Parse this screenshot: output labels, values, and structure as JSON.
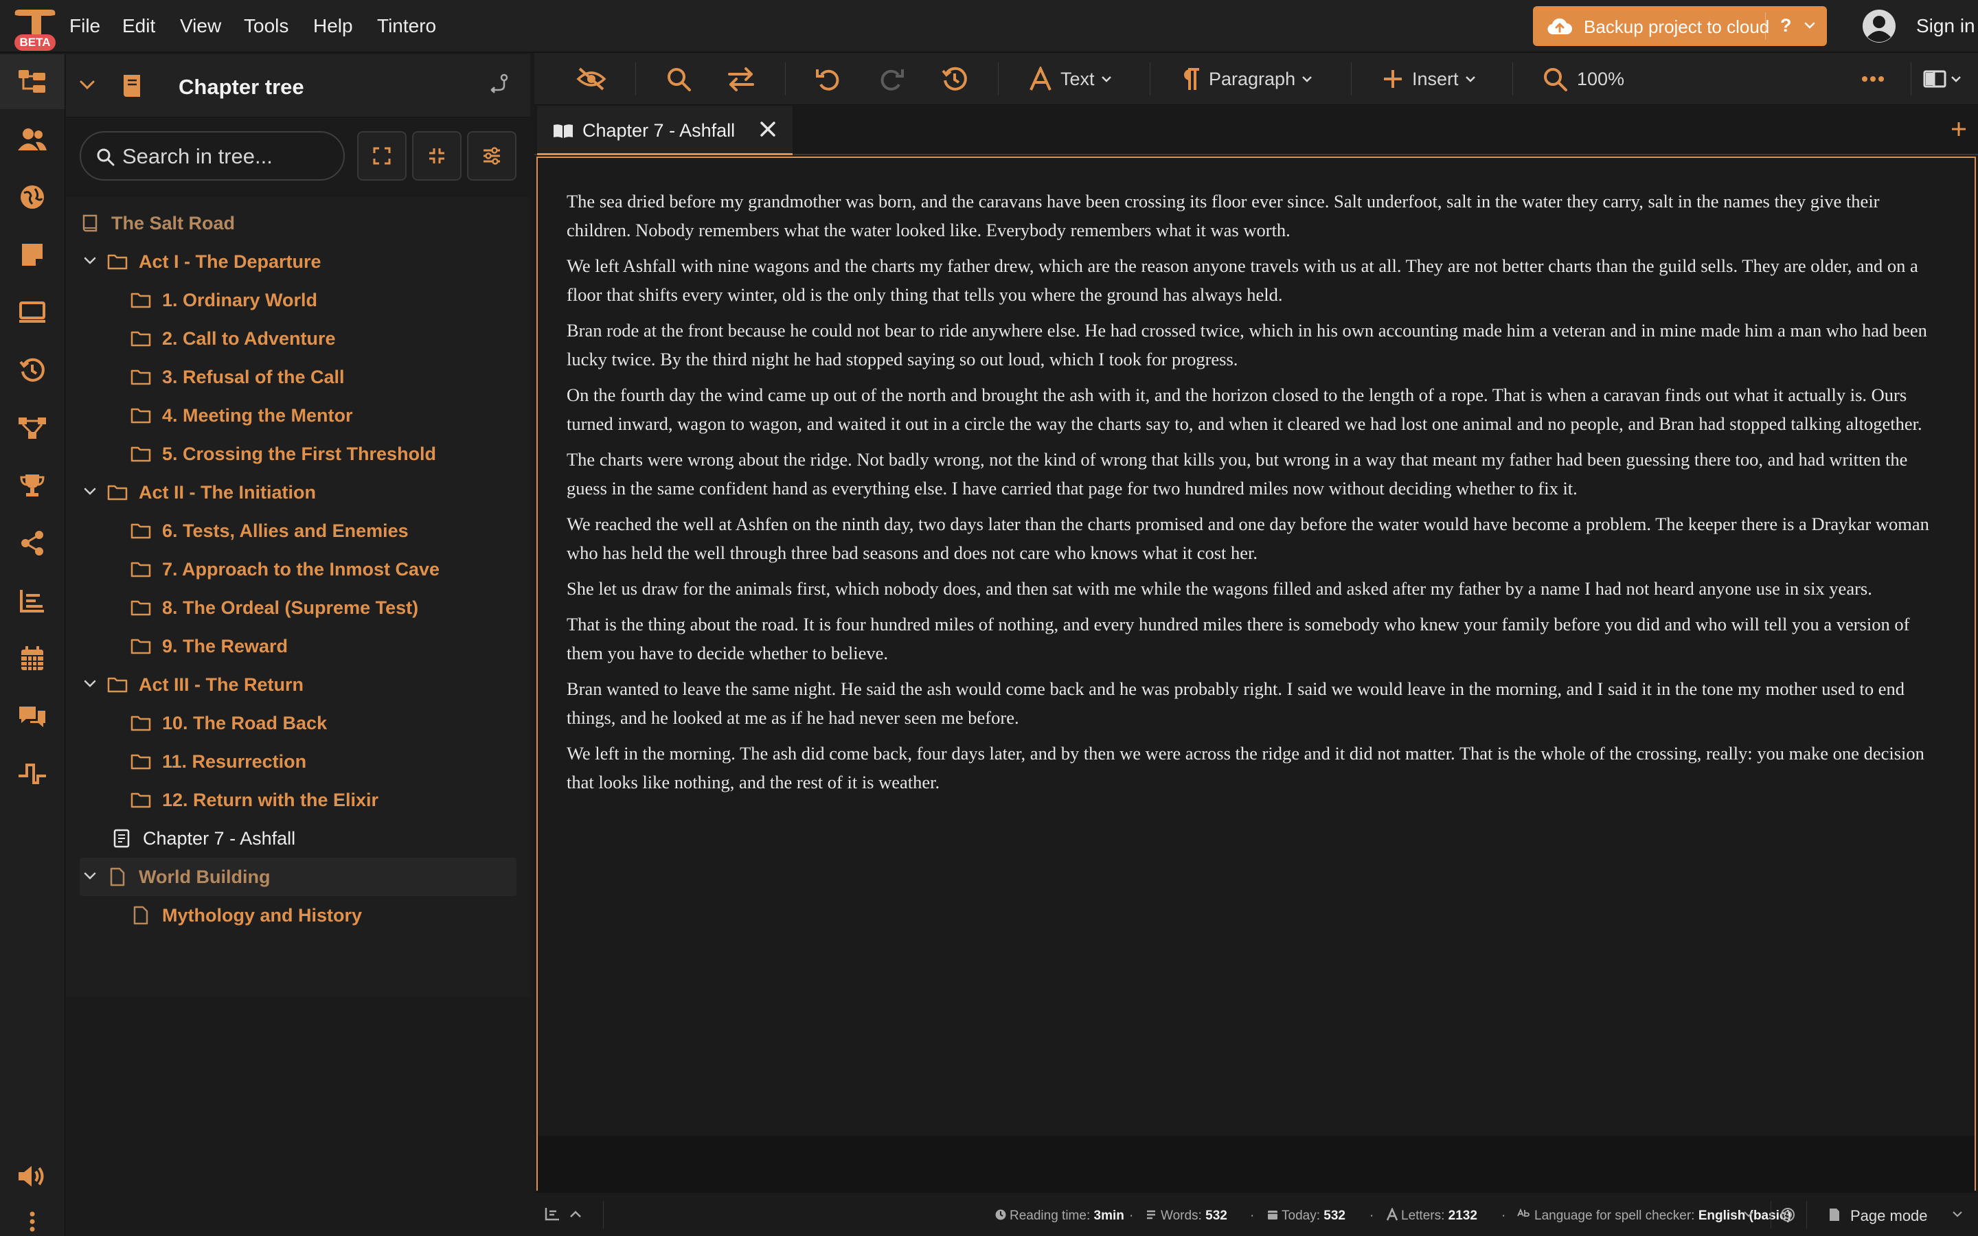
{
  "app": {
    "badge": "BETA",
    "menu": [
      "File",
      "Edit",
      "View",
      "Tools",
      "Help",
      "Tintero"
    ],
    "backup_label": "Backup project to cloud",
    "help_label": "?",
    "signin_label": "Sign in",
    "accent": "#e0914c"
  },
  "rail": {
    "icons": [
      "chapter-tree-icon",
      "characters-icon",
      "world-icon",
      "notes-icon",
      "presentation-icon",
      "history-icon",
      "plot-structure-icon",
      "goals-trophy-icon",
      "share-icon",
      "statistics-icon",
      "calendar-icon",
      "chat-icon",
      "timeline-icon",
      "sound-icon",
      "more-vertical-icon"
    ]
  },
  "sidebar": {
    "title": "Chapter tree",
    "search_placeholder": "Search in tree...",
    "tree": [
      {
        "label": "The Salt Road",
        "kind": "book",
        "level": 0,
        "style": "muted"
      },
      {
        "label": "Act I - The Departure",
        "kind": "folder",
        "level": 1,
        "expanded": true
      },
      {
        "label": "1. Ordinary World",
        "kind": "folder",
        "level": 2
      },
      {
        "label": "2. Call to Adventure",
        "kind": "folder",
        "level": 2
      },
      {
        "label": "3. Refusal of the Call",
        "kind": "folder",
        "level": 2
      },
      {
        "label": "4. Meeting the Mentor",
        "kind": "folder",
        "level": 2
      },
      {
        "label": "5. Crossing the First Threshold",
        "kind": "folder",
        "level": 2
      },
      {
        "label": "Act II - The Initiation",
        "kind": "folder",
        "level": 1,
        "expanded": true
      },
      {
        "label": "6. Tests, Allies and Enemies",
        "kind": "folder",
        "level": 2
      },
      {
        "label": "7. Approach to the Inmost Cave",
        "kind": "folder",
        "level": 2
      },
      {
        "label": "8. The Ordeal (Supreme Test)",
        "kind": "folder",
        "level": 2
      },
      {
        "label": "9. The Reward",
        "kind": "folder",
        "level": 2
      },
      {
        "label": "Act III - The Return",
        "kind": "folder",
        "level": 1,
        "expanded": true
      },
      {
        "label": "10. The Road Back",
        "kind": "folder",
        "level": 2
      },
      {
        "label": "11. Resurrection",
        "kind": "folder",
        "level": 2
      },
      {
        "label": "12. Return with the Elixir",
        "kind": "folder",
        "level": 2
      },
      {
        "label": "Chapter 7 - Ashfall",
        "kind": "chapter",
        "level": 1,
        "style": "plain"
      },
      {
        "label": "World Building",
        "kind": "page",
        "level": 1,
        "expanded": true,
        "style": "muted",
        "highlight": true
      },
      {
        "label": "Mythology and History",
        "kind": "page",
        "level": 2
      }
    ]
  },
  "toolbar": {
    "text_label": "Text",
    "paragraph_label": "Paragraph",
    "insert_label": "Insert",
    "zoom_label": "100%"
  },
  "tab": {
    "title": "Chapter 7 - Ashfall"
  },
  "document": {
    "paragraphs": [
      "The sea dried before my grandmother was born, and the caravans have been crossing its floor ever since. Salt underfoot, salt in the water they carry, salt in the names they give their children. Nobody remembers what the water looked like. Everybody remembers what it was worth.",
      "We left Ashfall with nine wagons and the charts my father drew, which are the reason anyone travels with us at all. They are not better charts than the guild sells. They are older, and on a floor that shifts every winter, old is the only thing that tells you where the ground has always held.",
      "Bran rode at the front because he could not bear to ride anywhere else. He had crossed twice, which in his own accounting made him a veteran and in mine made him a man who had been lucky twice. By the third night he had stopped saying so out loud, which I took for progress.",
      "On the fourth day the wind came up out of the north and brought the ash with it, and the horizon closed to the length of a rope. That is when a caravan finds out what it actually is. Ours turned inward, wagon to wagon, and waited it out in a circle the way the charts say to, and when it cleared we had lost one animal and no people, and Bran had stopped talking altogether.",
      "The charts were wrong about the ridge. Not badly wrong, not the kind of wrong that kills you, but wrong in a way that meant my father had been guessing there too, and had written the guess in the same confident hand as everything else. I have carried that page for two hundred miles now without deciding whether to fix it.",
      "We reached the well at Ashfen on the ninth day, two days later than the charts promised and one day before the water would have become a problem. The keeper there is a Draykar woman who has held the well through three bad seasons and does not care who knows what it cost her.",
      "She let us draw for the animals first, which nobody does, and then sat with me while the wagons filled and asked after my father by a name I had not heard anyone use in six years.",
      "That is the thing about the road. It is four hundred miles of nothing, and every hundred miles there is somebody who knew your family before you did and who will tell you a version of them you have to decide whether to believe.",
      "Bran wanted to leave the same night. He said the ash would come back and he was probably right. I said we would leave in the morning, and I said it in the tone my mother used to end things, and he looked at me as if he had never seen me before.",
      "We left in the morning. The ash did come back, four days later, and by then we were across the ridge and it did not matter. That is the whole of the crossing, really: you make one decision that looks like nothing, and the rest of it is weather."
    ]
  },
  "status": {
    "reading_label": "Reading time:",
    "reading_value": "3min",
    "words_label": "Words:",
    "words_value": "532",
    "today_label": "Today:",
    "today_value": "532",
    "letters_label": "Letters:",
    "letters_value": "2132",
    "spell_label": "Language for spell checker:",
    "spell_value": "English (basic)",
    "page_mode_label": "Page mode"
  }
}
